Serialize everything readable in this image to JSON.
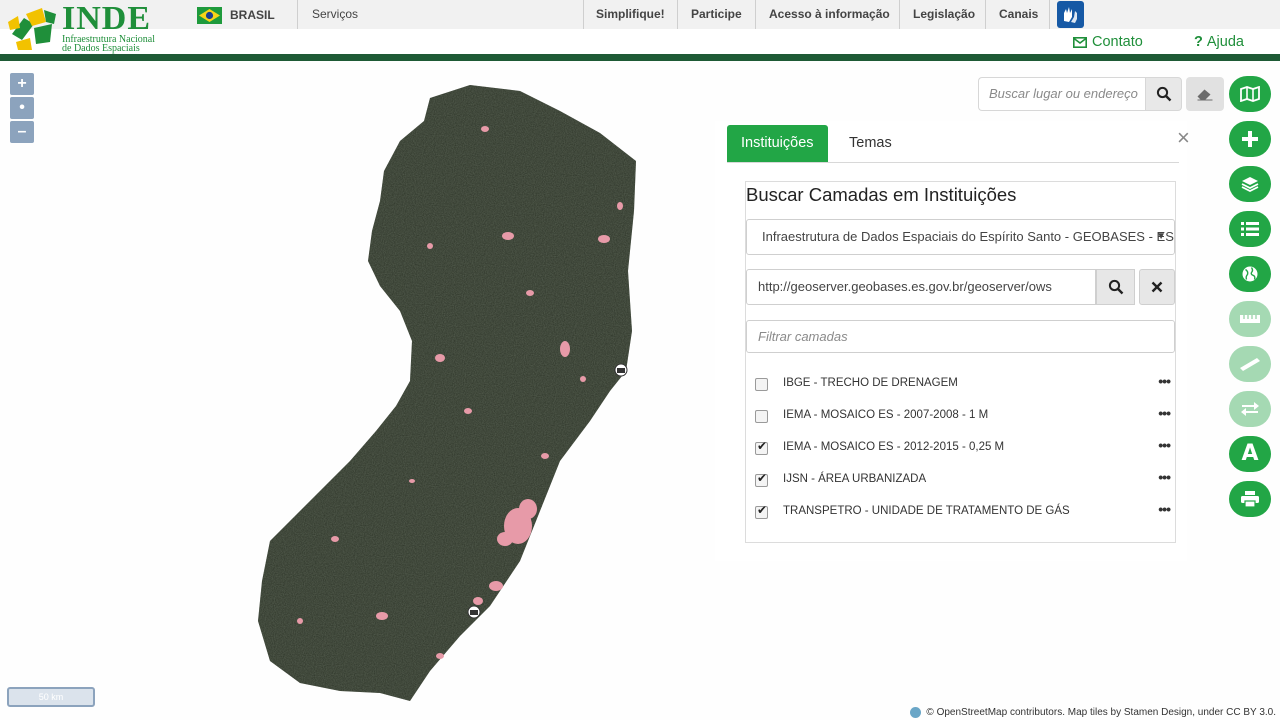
{
  "header": {
    "logo": {
      "name": "INDE",
      "subtitle_line1": "Infraestrutura  Nacional",
      "subtitle_line2": "de Dados Espaciais"
    },
    "gov": {
      "label": "BRASIL",
      "flag_icon": "brazil-flag-icon"
    },
    "nav_left": [
      {
        "label": "Serviços"
      }
    ],
    "nav_right": [
      {
        "label": "Simplifique!"
      },
      {
        "label": "Participe"
      },
      {
        "label": "Acesso à informação"
      },
      {
        "label": "Legislação"
      },
      {
        "label": "Canais"
      }
    ],
    "accessibility_icon": "sign-language-icon",
    "contact": "Contato",
    "help": "Ajuda",
    "colors": {
      "brand_green": "#1f8f3a",
      "header_rule": "#1e5a35",
      "gov_blue": "#1659a5"
    }
  },
  "map": {
    "zoom_in": "+",
    "zoom_reset": "•",
    "zoom_out": "–",
    "scale": "50 km",
    "attribution": "© OpenStreetMap contributors. Map tiles by Stamen Design, under CC BY 3.0.",
    "search_placeholder": "Buscar lugar ou endereço"
  },
  "toolbar": {
    "buttons": [
      {
        "icon": "map-icon",
        "enabled": true
      },
      {
        "icon": "plus-icon",
        "enabled": true
      },
      {
        "icon": "layers-icon",
        "enabled": true
      },
      {
        "icon": "list-icon",
        "enabled": true
      },
      {
        "icon": "globe-icon",
        "enabled": true
      },
      {
        "icon": "ruler-icon",
        "enabled": false
      },
      {
        "icon": "measure-line-icon",
        "enabled": false
      },
      {
        "icon": "swap-arrows-icon",
        "enabled": false
      },
      {
        "icon": "text-annotation-icon",
        "enabled": true,
        "label": "A"
      },
      {
        "icon": "print-icon",
        "enabled": true
      }
    ],
    "accent": "#22a646",
    "disabled": "#a5d9b3"
  },
  "panel": {
    "tabs": [
      {
        "label": "Instituições",
        "active": true
      },
      {
        "label": "Temas",
        "active": false
      }
    ],
    "close": "×",
    "title": "Buscar Camadas em Instituições",
    "institution_selected": "Infraestrutura de Dados Espaciais do Espírito Santo - GEOBASES - ES",
    "url_value": "http://geoserver.geobases.es.gov.br/geoserver/ows",
    "filter_placeholder": "Filtrar camadas",
    "layers": [
      {
        "label": "IBGE - TRECHO DE DRENAGEM",
        "checked": false
      },
      {
        "label": "IEMA - MOSAICO ES - 2007-2008 - 1 M",
        "checked": false
      },
      {
        "label": "IEMA - MOSAICO ES - 2012-2015 - 0,25 M",
        "checked": true
      },
      {
        "label": "IJSN - ÁREA URBANIZADA",
        "checked": true
      },
      {
        "label": "TRANSPETRO - UNIDADE DE TRATAMENTO DE GÁS",
        "checked": true
      }
    ],
    "more_label": "•••",
    "check_mark": "✔"
  }
}
